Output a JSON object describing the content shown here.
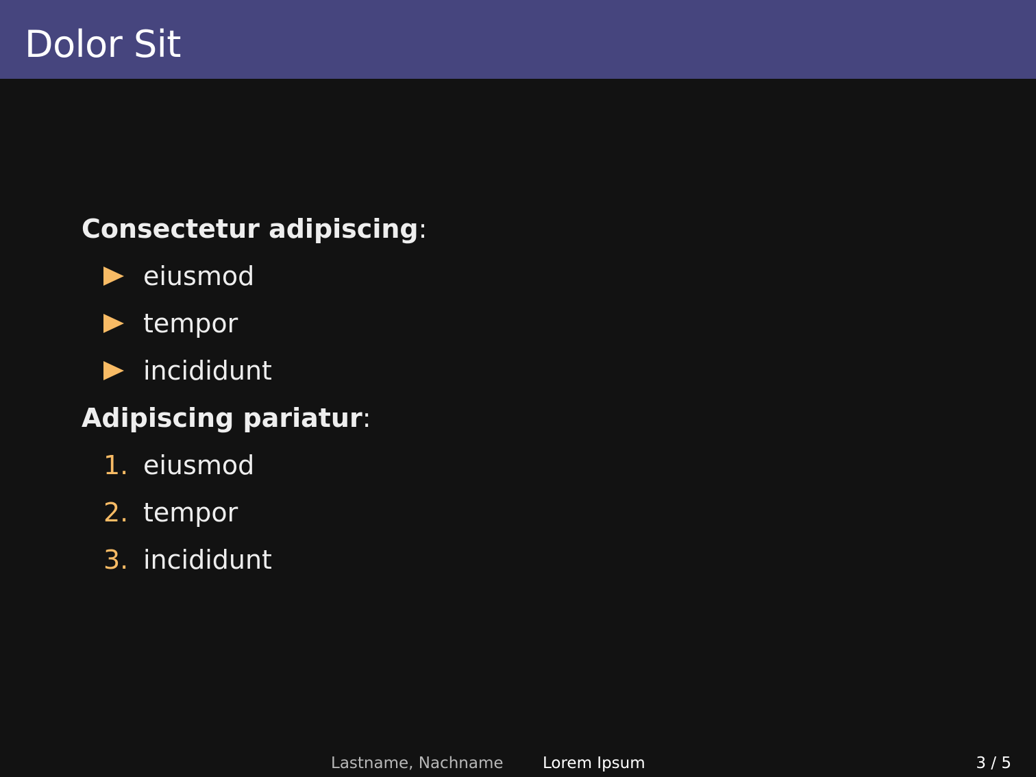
{
  "header": {
    "title": "Dolor Sit"
  },
  "sections": [
    {
      "heading": "Consectetur adipiscing",
      "suffix": ":",
      "items": [
        "eiusmod",
        "tempor",
        "incididunt"
      ]
    },
    {
      "heading": "Adipiscing pariatur",
      "suffix": ":",
      "markers": [
        "1.",
        "2.",
        "3."
      ],
      "items": [
        "eiusmod",
        "tempor",
        "incididunt"
      ]
    }
  ],
  "footer": {
    "author": "Lastname, Nachname",
    "title": "Lorem Ipsum",
    "page": "3 / 5"
  },
  "colors": {
    "header_bg": "#46457e",
    "slide_bg": "#121212",
    "marker": "#f8bb65"
  },
  "icons": {
    "bullet": "triangle-right-icon"
  }
}
